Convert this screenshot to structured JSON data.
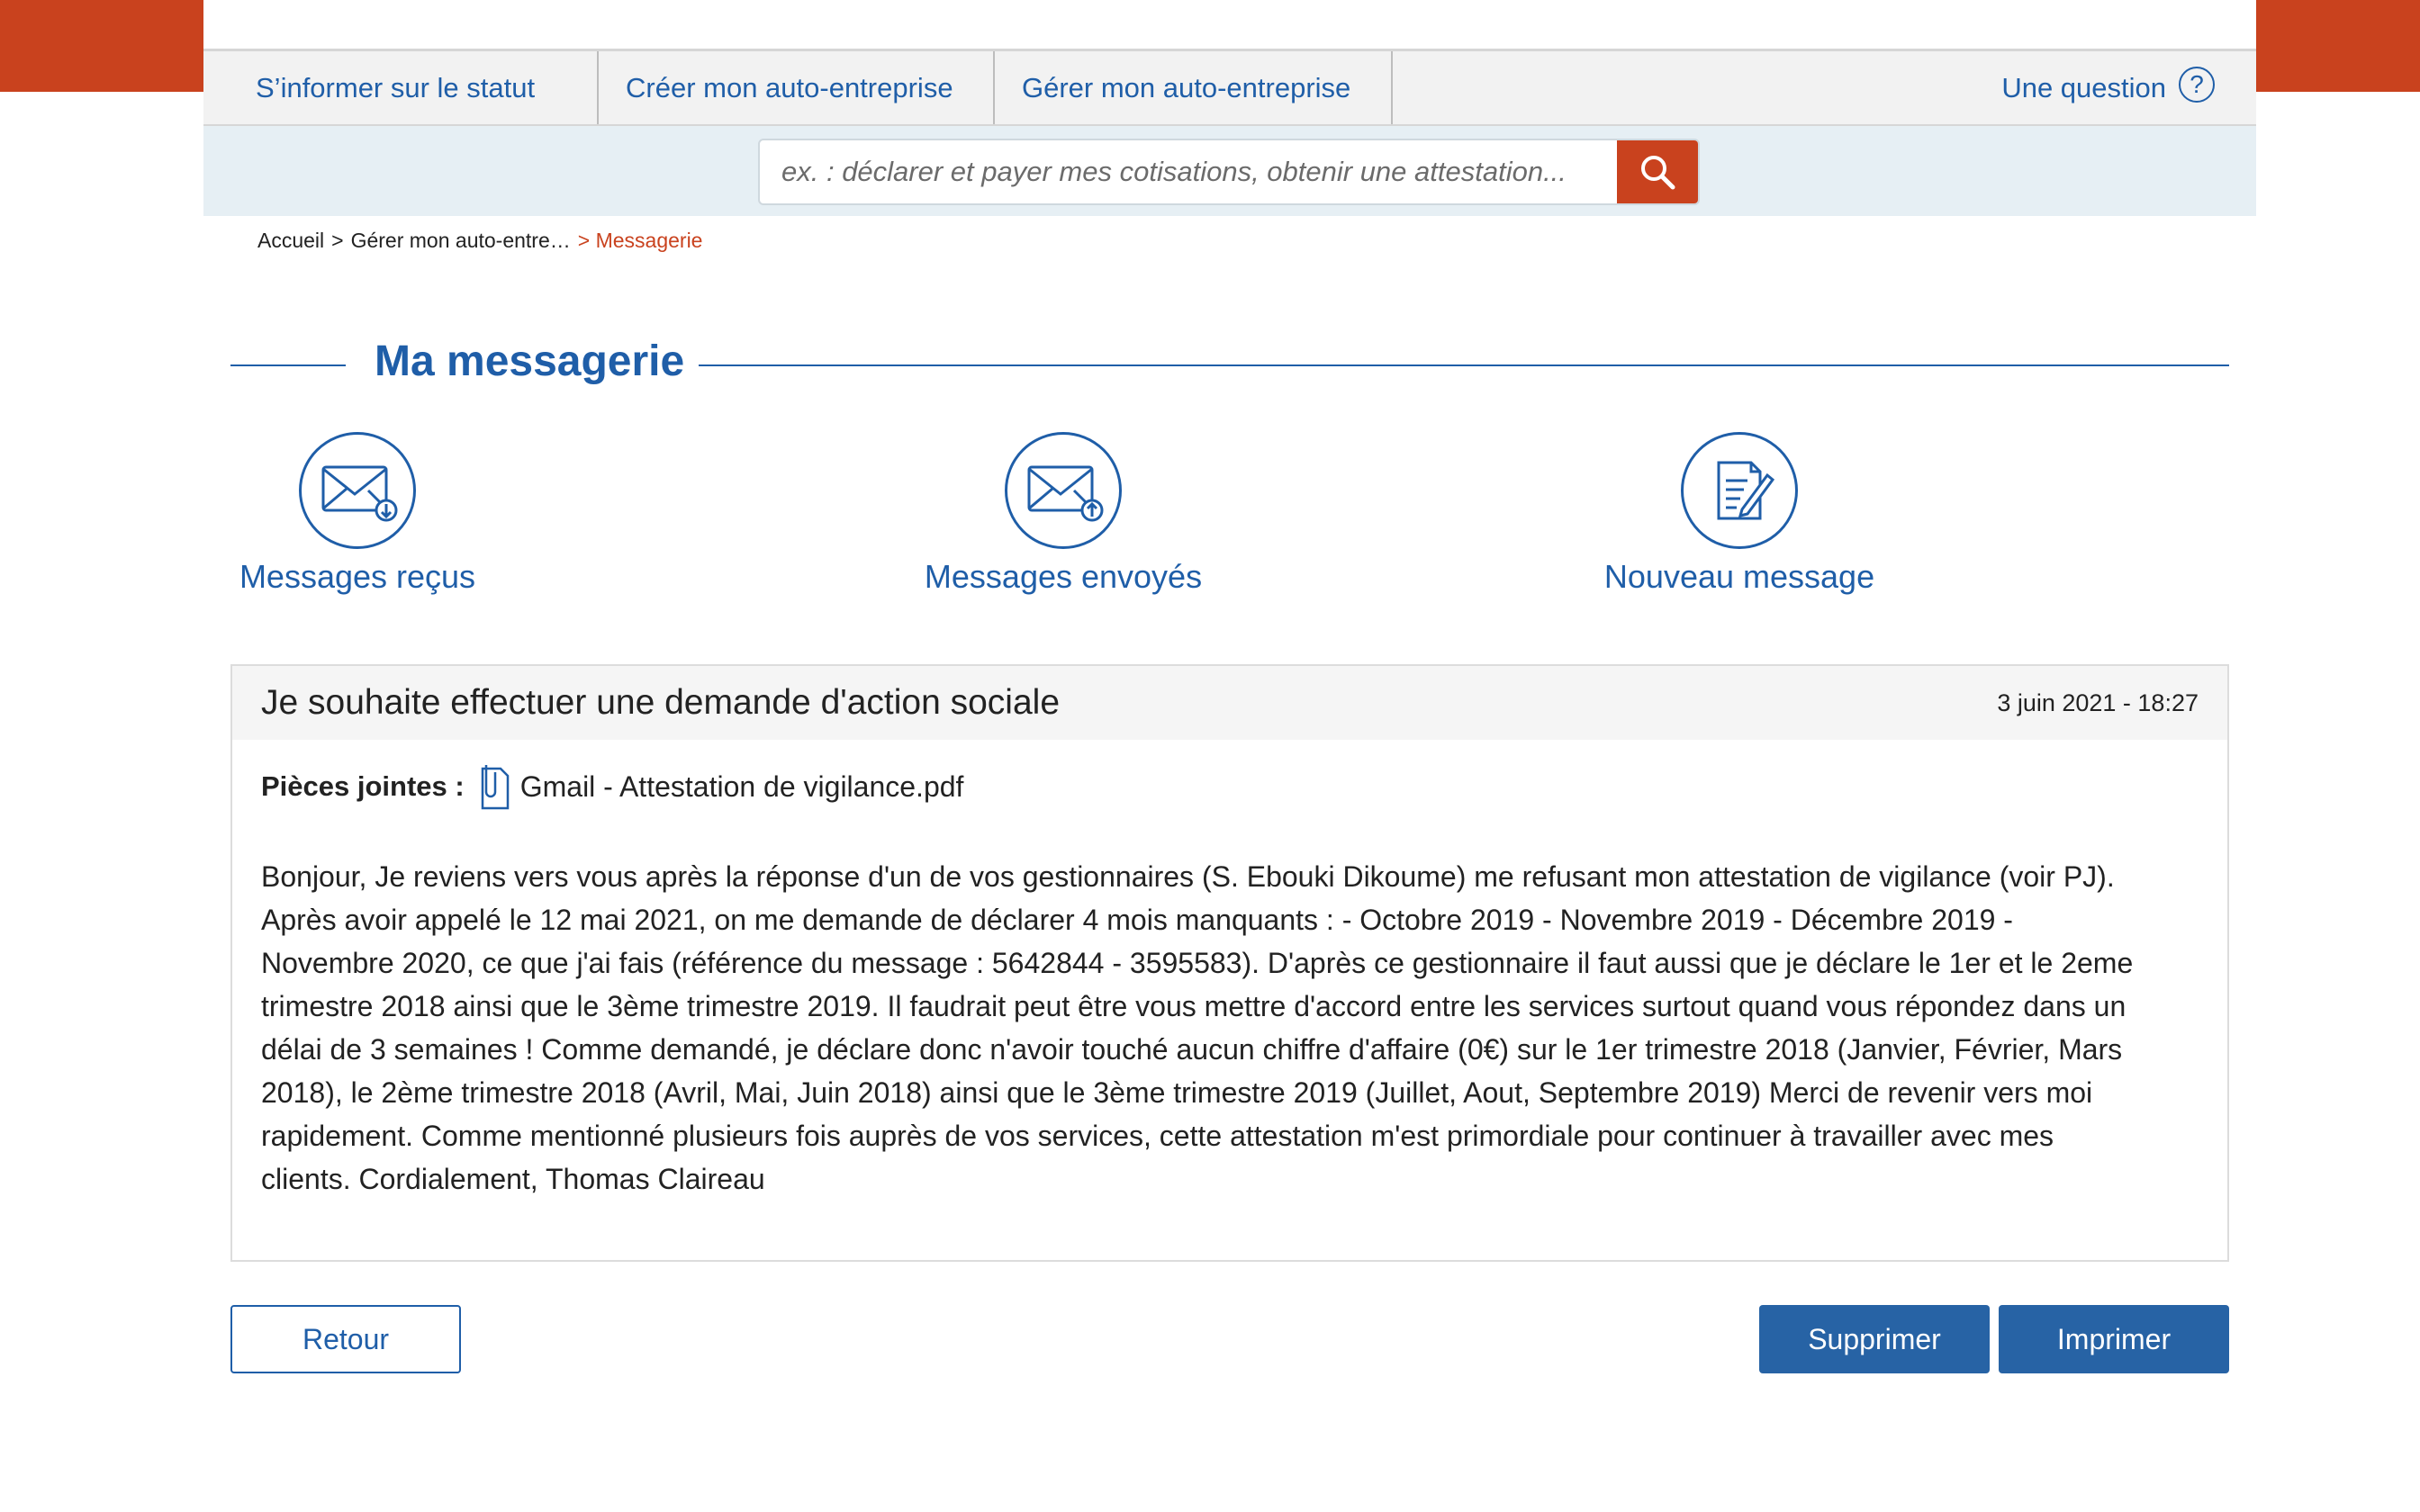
{
  "nav": {
    "items": [
      {
        "label": "S’informer sur le statut"
      },
      {
        "label": "Créer mon auto-entreprise"
      },
      {
        "label": "Gérer mon auto-entreprise"
      }
    ],
    "question_label": "Une question",
    "question_icon": "?"
  },
  "search": {
    "placeholder": "ex. : déclarer et payer mes cotisations, obtenir une attestation...",
    "icon": "search-icon"
  },
  "breadcrumb": {
    "home": "Accueil",
    "sep1": ">",
    "parent": "Gérer mon auto-entre…",
    "current": "> Messagerie"
  },
  "page": {
    "title": "Ma messagerie"
  },
  "actions": {
    "received": {
      "label": "Messages reçus",
      "icon": "envelope-download-icon"
    },
    "sent": {
      "label": "Messages envoyés",
      "icon": "envelope-upload-icon"
    },
    "new": {
      "label": "Nouveau message",
      "icon": "document-pen-icon"
    }
  },
  "message": {
    "subject": "Je souhaite effectuer une demande d'action sociale",
    "date": "3 juin 2021 - 18:27",
    "attachments_label": "Pièces jointes :",
    "attachment_name": "Gmail - Attestation de vigilance.pdf",
    "attachment_icon": "paperclip-document-icon",
    "body": "Bonjour, Je reviens vers vous après la réponse d'un de vos gestionnaires (S. Ebouki Dikoume) me refusant mon attestation de vigilance (voir PJ). Après avoir appelé le 12 mai 2021, on me demande de déclarer 4 mois manquants : - Octobre 2019 - Novembre 2019 - Décembre 2019 - Novembre 2020, ce que j'ai fais (référence du message : 5642844 - 3595583). D'après ce gestionnaire il faut aussi que je déclare le 1er et le 2eme trimestre 2018 ainsi que le 3ème trimestre 2019. Il faudrait peut être vous mettre d'accord entre les services surtout quand vous répondez dans un délai de 3 semaines ! Comme demandé, je déclare donc n'avoir touché aucun chiffre d'affaire (0€) sur le 1er trimestre 2018 (Janvier, Février, Mars 2018), le 2ème trimestre 2018 (Avril, Mai, Juin 2018) ainsi que le 3ème trimestre 2019 (Juillet, Aout, Septembre 2019) Merci de revenir vers moi rapidement. Comme mentionné plusieurs fois auprès de vos services, cette attestation m'est primordiale pour continuer à travailler avec mes clients. Cordialement, Thomas Claireau"
  },
  "buttons": {
    "back": "Retour",
    "delete": "Supprimer",
    "print": "Imprimer"
  },
  "colors": {
    "accent_orange": "#c9421e",
    "primary_blue": "#1f5ea8",
    "button_blue": "#2763a5",
    "search_band": "#e6eff4"
  }
}
